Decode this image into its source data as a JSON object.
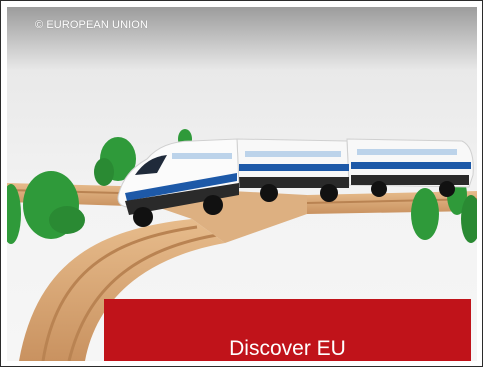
{
  "slide": {
    "copyright": "© EUROPEAN UNION",
    "caption": "Discover EU",
    "image_subject": "wooden-toy-train-on-track",
    "colors": {
      "caption_bg": "#c0131a",
      "caption_text": "#ffffff",
      "track": "#d9a774",
      "tree": "#2f9a3a",
      "train_body": "#ffffff",
      "train_stripe": "#1d59a8"
    }
  }
}
